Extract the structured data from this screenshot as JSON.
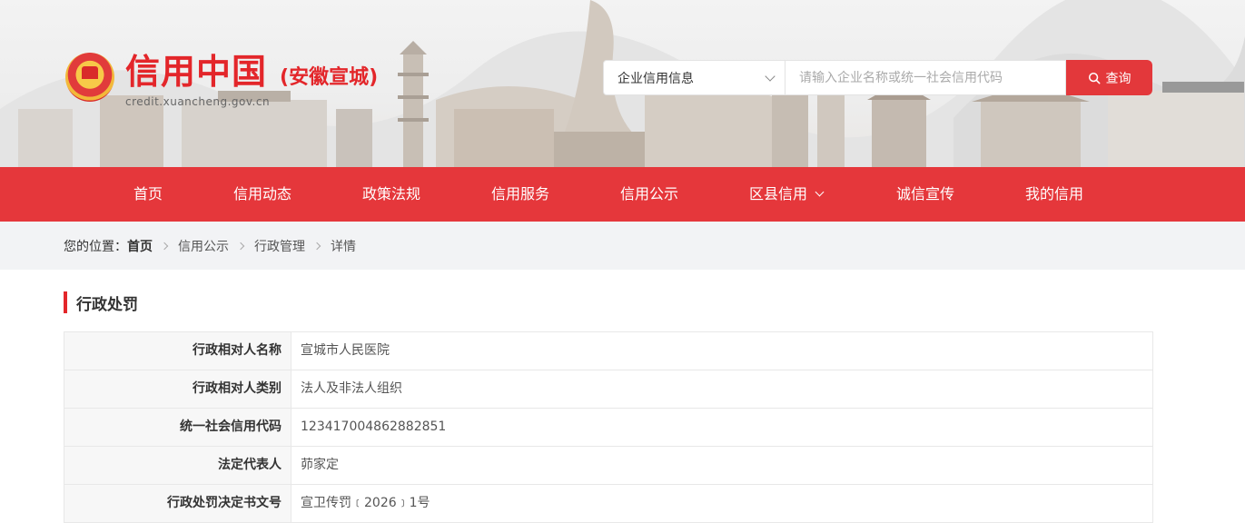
{
  "header": {
    "logo_title": "信用中国",
    "logo_region": "(安徽宣城)",
    "logo_domain": "credit.xuancheng.gov.cn",
    "search": {
      "category": "企业信用信息",
      "placeholder": "请输入企业名称或统一社会信用代码",
      "button_label": "查询"
    }
  },
  "nav": {
    "items": [
      {
        "label": "首页"
      },
      {
        "label": "信用动态"
      },
      {
        "label": "政策法规"
      },
      {
        "label": "信用服务"
      },
      {
        "label": "信用公示"
      },
      {
        "label": "区县信用"
      },
      {
        "label": "诚信宣传"
      },
      {
        "label": "我的信用"
      }
    ]
  },
  "breadcrumb": {
    "lead": "您的位置：",
    "home": "首页",
    "items": [
      "信用公示",
      "行政管理",
      "详情"
    ]
  },
  "section": {
    "title": "行政处罚"
  },
  "detail": {
    "rows": [
      {
        "label": "行政相对人名称",
        "value": "宣城市人民医院"
      },
      {
        "label": "行政相对人类别",
        "value": "法人及非法人组织"
      },
      {
        "label": "统一社会信用代码",
        "value": "123417004862882851"
      },
      {
        "label": "法定代表人",
        "value": "茆家定"
      },
      {
        "label": "行政处罚决定书文号",
        "value": "宣卫传罚﹝2026﹞1号"
      }
    ]
  },
  "colors": {
    "brand_red": "#e5373b",
    "breadcrumb_bg": "#f2f3f5"
  }
}
